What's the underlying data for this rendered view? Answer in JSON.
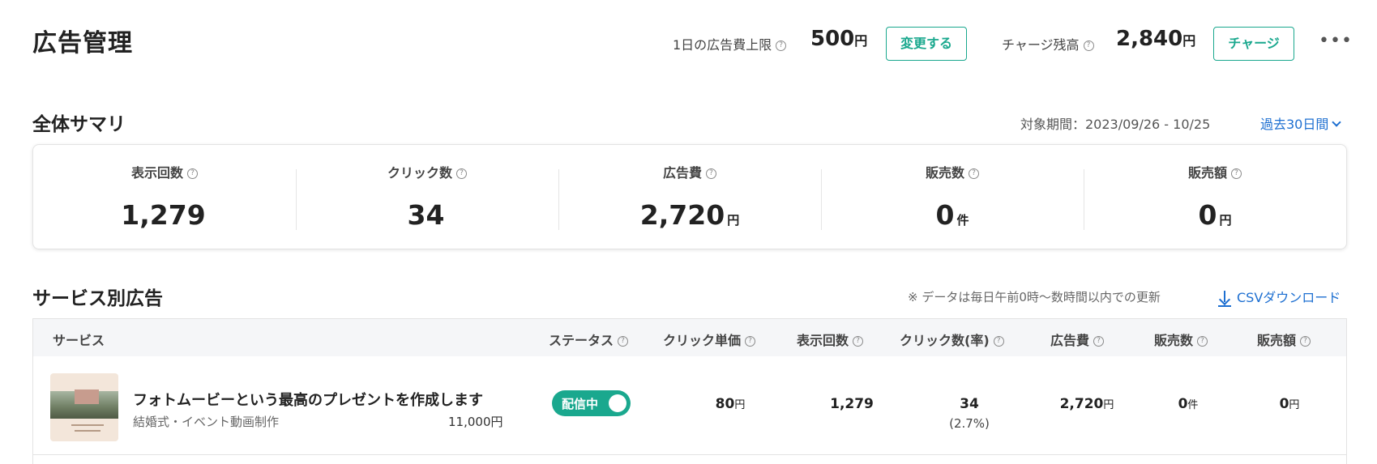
{
  "header": {
    "title": "広告管理",
    "daily_limit_label": "1日の広告費上限",
    "daily_limit_value": "500",
    "daily_limit_unit": "円",
    "change_button": "変更する",
    "balance_label": "チャージ残高",
    "balance_value": "2,840",
    "balance_unit": "円",
    "charge_button": "チャージ",
    "more_icon": "more-horizontal-icon"
  },
  "summary": {
    "title": "全体サマリ",
    "period_label": "対象期間：2023/09/26 - 10/25",
    "period_select": "過去30日間",
    "metrics": [
      {
        "label": "表示回数",
        "value": "1,279",
        "unit": ""
      },
      {
        "label": "クリック数",
        "value": "34",
        "unit": ""
      },
      {
        "label": "広告費",
        "value": "2,720",
        "unit": "円"
      },
      {
        "label": "販売数",
        "value": "0",
        "unit": "件"
      },
      {
        "label": "販売額",
        "value": "0",
        "unit": "円"
      }
    ]
  },
  "services": {
    "title": "サービス別広告",
    "update_note": "※ データは毎日午前0時～数時間以内での更新",
    "csv_download": "CSVダウンロード",
    "columns": {
      "service": "サービス",
      "status": "ステータス",
      "cpc": "クリック単価",
      "impressions": "表示回数",
      "clicks": "クリック数(率)",
      "cost": "広告費",
      "sales_count": "販売数",
      "sales_amount": "販売額"
    },
    "rows": [
      {
        "name": "フォトムービーという最高のプレゼントを作成します",
        "category": "結婚式・イベント動画制作",
        "price": "11,000円",
        "status": "配信中",
        "status_on": true,
        "cpc": "80",
        "cpc_unit": "円",
        "impressions": "1,279",
        "clicks": "34",
        "click_rate": "(2.7%)",
        "cost": "2,720",
        "cost_unit": "円",
        "sales_count": "0",
        "sales_count_unit": "件",
        "sales_amount": "0",
        "sales_amount_unit": "円"
      }
    ]
  },
  "colors": {
    "accent": "#1aa88e",
    "link": "#1d6fd1"
  }
}
